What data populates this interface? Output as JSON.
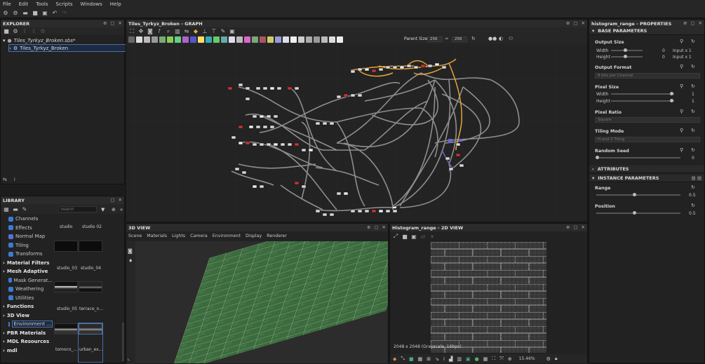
{
  "menu": [
    "File",
    "Edit",
    "Tools",
    "Scripts",
    "Windows",
    "Help"
  ],
  "explorer": {
    "title": "EXPLORER",
    "file": "Tiles_Tyrkyz_Broken.sbs*",
    "graph": "Tiles_Tyrkyz_Broken"
  },
  "graph": {
    "title": "Tiles_Tyrkyz_Broken - GRAPH",
    "parent_size_label": "Parent Size:",
    "size_w": "256",
    "size_h": "256"
  },
  "properties": {
    "title": "histogram_range - PROPERTIES",
    "base_parameters": "BASE PARAMETERS",
    "output_size": "Output Size",
    "width_label": "Width",
    "height_label": "Height",
    "out_w_val": "0",
    "out_h_val": "0",
    "out_w_unit": "Input x 1",
    "out_h_unit": "Input x 1",
    "output_format": "Output Format",
    "output_format_val": "8 bits per Channel",
    "pixel_size": "Pixel Size",
    "px_w_val": "1",
    "px_h_val": "1",
    "pixel_ratio": "Pixel Ratio",
    "pixel_ratio_val": "Square",
    "tiling_mode": "Tiling Mode",
    "tiling_val": "H and V Tiling",
    "random_seed": "Random Seed",
    "seed_val": "0",
    "attributes": "ATTRIBUTES",
    "instance_parameters": "INSTANCE PARAMETERS",
    "range": "Range",
    "range_val": "0.5",
    "position": "Position",
    "position_val": "0.5"
  },
  "library": {
    "title": "LIBRARY",
    "search_placeholder": "Search",
    "items": [
      {
        "label": "Channels",
        "sub": true,
        "color": "#3a7bd5"
      },
      {
        "label": "Effects",
        "sub": true,
        "color": "#3a7bd5"
      },
      {
        "label": "Normal Map",
        "sub": true,
        "color": "#5b6fd8"
      },
      {
        "label": "Tiling",
        "sub": true,
        "color": "#3a7bd5"
      },
      {
        "label": "Transforms",
        "sub": true,
        "color": "#3a7bd5"
      },
      {
        "label": "Material Filters",
        "sub": false
      },
      {
        "label": "Mesh Adaptive",
        "sub": false
      },
      {
        "label": "Mask Generat...",
        "sub": true,
        "color": "#3a7bd5"
      },
      {
        "label": "Weathering",
        "sub": true,
        "color": "#3a7bd5"
      },
      {
        "label": "Utilities",
        "sub": true,
        "color": "#3a7bd5"
      },
      {
        "label": "Functions",
        "sub": false
      },
      {
        "label": "3D View",
        "sub": false
      },
      {
        "label": "Environment ...",
        "sub": true,
        "color": "#3a7bd5",
        "selected": true
      },
      {
        "label": "PBR Materials",
        "sub": false
      },
      {
        "label": "MDL Resources",
        "sub": false
      },
      {
        "label": "mdl",
        "sub": false
      }
    ],
    "thumbs": [
      "studio",
      "studio 02",
      "studio_03",
      "studio_04",
      "studio_05",
      "terrace_n...",
      "tomoco_...",
      "urban_ex..."
    ]
  },
  "view3d": {
    "title": "3D VIEW",
    "menu": [
      "Scene",
      "Materials",
      "Lights",
      "Camera",
      "Environment",
      "Display",
      "Renderer"
    ]
  },
  "view2d": {
    "title": "Histogram_range - 2D VIEW",
    "info": "2048 x 2048 (Grayscale, 16bpc)",
    "zoom": "15.46%"
  }
}
